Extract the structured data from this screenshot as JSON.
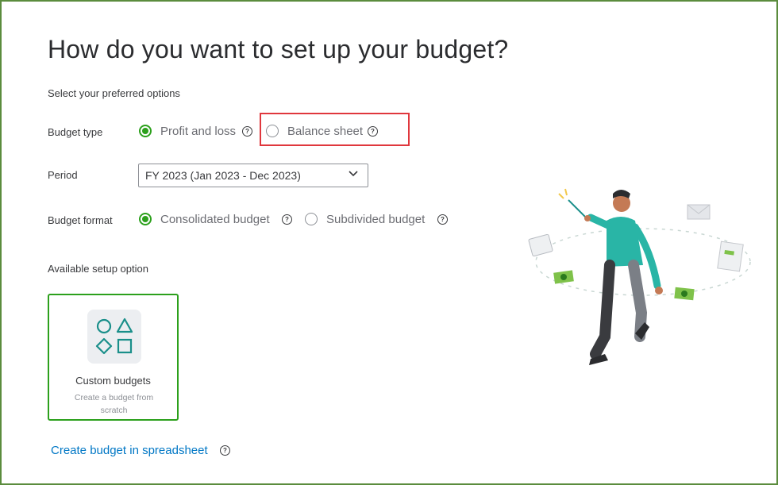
{
  "page": {
    "title": "How do you want to set up your budget?",
    "subtitle": "Select your preferred options"
  },
  "budget_type": {
    "label": "Budget type",
    "options": [
      "Profit and loss",
      "Balance sheet"
    ],
    "selected": "Profit and loss"
  },
  "period": {
    "label": "Period",
    "value": "FY 2023 (Jan 2023 - Dec 2023)"
  },
  "budget_format": {
    "label": "Budget format",
    "options": [
      "Consolidated budget",
      "Subdivided budget"
    ],
    "selected": "Consolidated budget"
  },
  "setup": {
    "label": "Available setup option",
    "card_title": "Custom budgets",
    "card_desc": "Create a budget from scratch"
  },
  "spreadsheet_link": "Create budget in spreadsheet",
  "help_glyph": "?",
  "colors": {
    "accent_green": "#2ca01c",
    "highlight_red": "#e0373d",
    "link_blue": "#0077c5",
    "teal": "#1a8f8a"
  }
}
